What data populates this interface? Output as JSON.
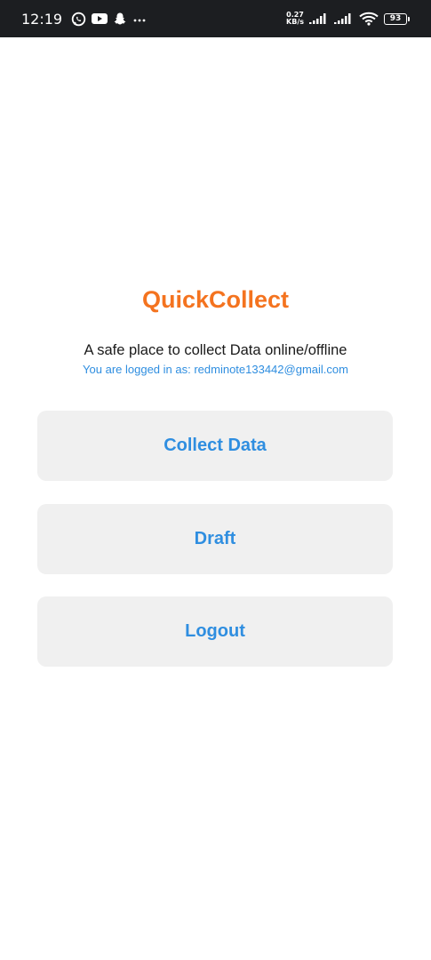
{
  "status_bar": {
    "time": "12:19",
    "speed_value": "0.27",
    "speed_unit": "KB/s",
    "battery": "93",
    "icons": [
      "whatsapp-icon",
      "youtube-icon",
      "snapchat-icon",
      "more-icon",
      "signal-icon",
      "signal-icon",
      "wifi-icon",
      "battery-icon"
    ]
  },
  "app": {
    "title": "QuickCollect",
    "tagline": "A safe place to collect Data online/offline",
    "login_info": "You are logged in as: redminote133442@gmail.com"
  },
  "buttons": {
    "collect": "Collect Data",
    "draft": "Draft",
    "logout": "Logout"
  },
  "colors": {
    "title": "#f4731f",
    "accent": "#2f8ee0",
    "button_bg": "#f0f0f0",
    "status_bar_bg": "#1c1e21"
  }
}
